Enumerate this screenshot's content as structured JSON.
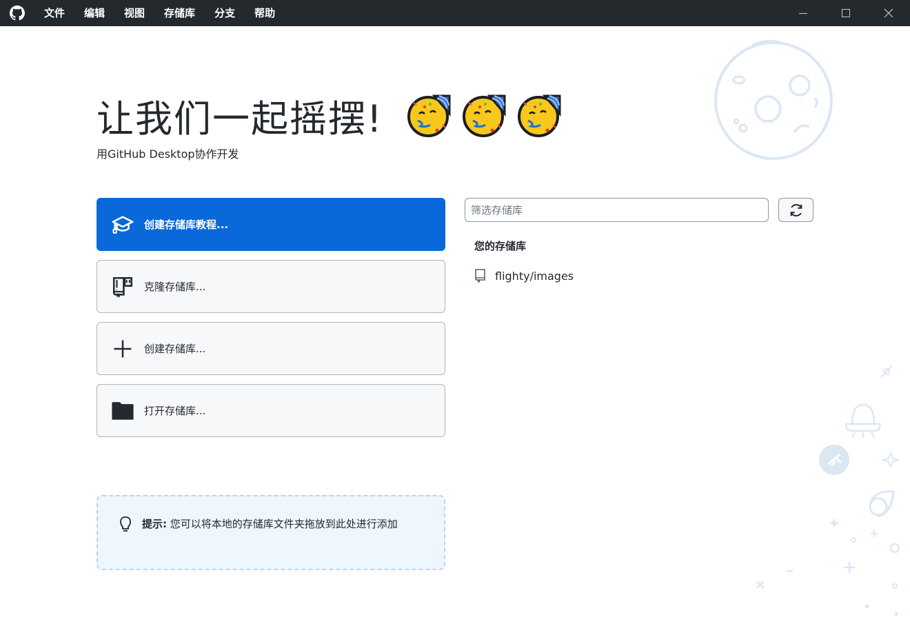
{
  "titlebar": {
    "logo_icon": "github-octocat-icon",
    "menu": [
      "文件",
      "编辑",
      "视图",
      "存储库",
      "分支",
      "帮助"
    ],
    "controls": [
      "minimize-icon",
      "maximize-icon",
      "close-icon"
    ]
  },
  "welcome": {
    "headline": "让我们一起摇摆!",
    "emoji_count": 3,
    "subtitle": "用GitHub Desktop协作开发"
  },
  "actions": [
    {
      "label": "创建存储库教程...",
      "icon": "mortarboard-icon",
      "primary": true
    },
    {
      "label": "克隆存储库...",
      "icon": "repo-clone-icon",
      "primary": false
    },
    {
      "label": "创建存储库...",
      "icon": "plus-icon",
      "primary": false
    },
    {
      "label": "打开存储库...",
      "icon": "folder-icon",
      "primary": false
    }
  ],
  "tip": {
    "bold": "提示:",
    "text": "您可以将本地的存储库文件夹拖放到此处进行添加",
    "icon": "light-bulb-icon"
  },
  "repo_list": {
    "filter_placeholder": "筛选存储库",
    "filter_value": "",
    "refresh_icon": "sync-icon",
    "section_title": "您的存储库",
    "items": [
      {
        "name": "flighty/images",
        "icon": "repo-icon"
      }
    ]
  },
  "colors": {
    "titlebar": "#24292e",
    "primary": "#0969da",
    "tip_bg": "#f0f6fe",
    "tip_border": "#b9d4f1",
    "decor": "#dbe7f3"
  }
}
